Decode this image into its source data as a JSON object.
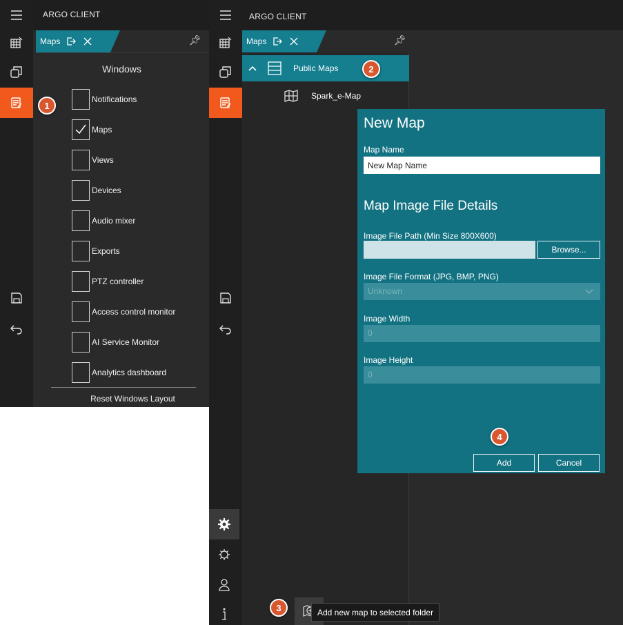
{
  "app": {
    "title": "ARGO CLIENT"
  },
  "left_panel": {
    "tab": {
      "label": "Maps"
    },
    "windows_title": "Windows",
    "windows": [
      {
        "label": "Notifications",
        "checked": false
      },
      {
        "label": "Maps",
        "checked": true
      },
      {
        "label": "Views",
        "checked": false
      },
      {
        "label": "Devices",
        "checked": false
      },
      {
        "label": "Audio mixer",
        "checked": false
      },
      {
        "label": "Exports",
        "checked": false
      },
      {
        "label": "PTZ controller",
        "checked": false
      },
      {
        "label": "Access control monitor",
        "checked": false
      },
      {
        "label": "AI Service Monitor",
        "checked": false
      },
      {
        "label": "Analytics dashboard",
        "checked": false
      }
    ],
    "reset_label": "Reset Windows Layout"
  },
  "right_panel": {
    "tab": {
      "label": "Maps"
    },
    "tree": {
      "folder": "Public Maps",
      "map_item": "Spark_e-Map"
    },
    "dialog": {
      "title": "New Map",
      "map_name_label": "Map Name",
      "map_name_value": "New Map Name",
      "section_title": "Map Image File Details",
      "path_label": "Image File Path (Min Size 800X600)",
      "browse_label": "Browse...",
      "format_label": "Image File Format (JPG, BMP, PNG)",
      "format_value": "Unknown",
      "width_label": "Image Width",
      "width_value": "0",
      "height_label": "Image Height",
      "height_value": "0",
      "add_label": "Add",
      "cancel_label": "Cancel"
    },
    "tooltip": "Add new map to selected folder"
  },
  "badges": {
    "b1": "1",
    "b2": "2",
    "b3": "3",
    "b4": "4"
  },
  "colors": {
    "accent_orange": "#f25a1d",
    "teal": "#157e8f",
    "dialog_teal": "#137282",
    "badge": "#d9572f"
  }
}
